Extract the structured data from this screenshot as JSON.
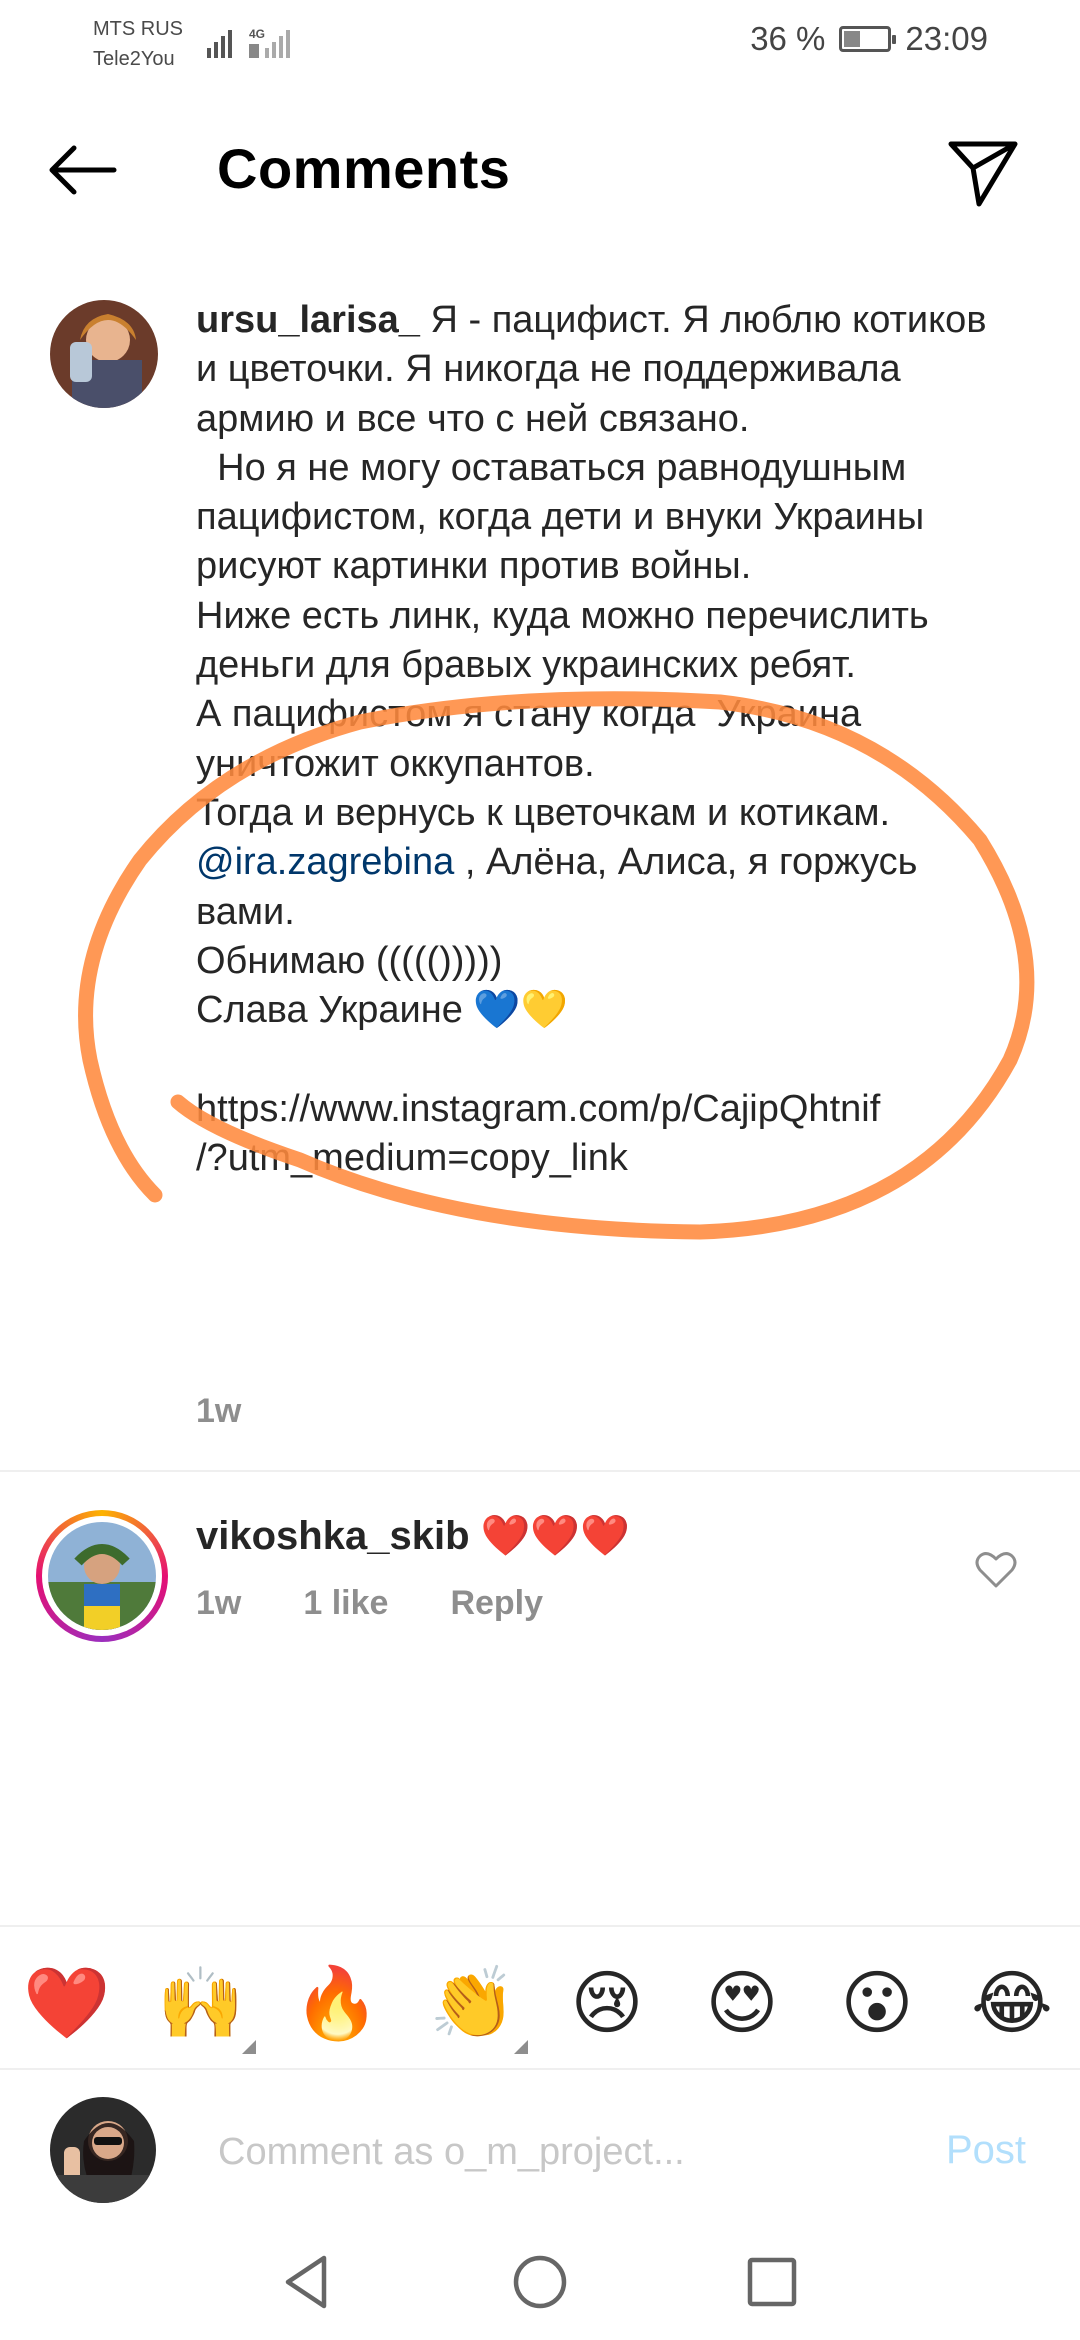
{
  "status_bar": {
    "carrier_1": "MTS RUS",
    "carrier_2": "Tele2You",
    "network": "4G",
    "battery": "36 %",
    "battery_level_percent": 36,
    "time": "23:09"
  },
  "header": {
    "title": "Comments",
    "back_icon": "arrow-left-icon",
    "send_icon": "paper-plane-icon"
  },
  "caption": {
    "username": "ursu_larisa_",
    "text_1": " Я - пацифист. Я люблю котиков и цветочки. Я никогда не поддерживала армию и все что с ней связано.\n  Но я не могу оставаться равнодушным пацифистом, когда дети и внуки Украины рисуют картинки против войны.\nНиже есть линк, куда можно перечислить деньги для бравых украинских ребят.\nА пацифистом я стану когда  Украина уничтожит оккупантов.\nТогда и вернусь к цветочкам и котикам.\n",
    "mention": "@ira.zagrebina",
    "text_2": " , Алёна, Алиса, я горжусь вами.\nОбнимаю ((((()))))\nСлава Украине 💙💛\n\nhttps://www.instagram.com/p/CajipQhtnif\n/?utm_medium=copy_link",
    "time": "1w"
  },
  "reply": {
    "username": "vikoshka_skib",
    "text": " ❤️❤️❤️",
    "time": "1w",
    "likes": "1 like",
    "reply_label": "Reply"
  },
  "emoji_bar": [
    "❤️",
    "🙌",
    "🔥",
    "👏",
    "😢",
    "😍",
    "😮",
    "😂"
  ],
  "comment_input": {
    "placeholder": "Comment as o_m_project...",
    "post_label": "Post"
  },
  "colors": {
    "annotation": "#ff8a3d",
    "post_disabled": "#b2dffc",
    "mention": "#00376b",
    "secondary_text": "#8e8e8e"
  }
}
